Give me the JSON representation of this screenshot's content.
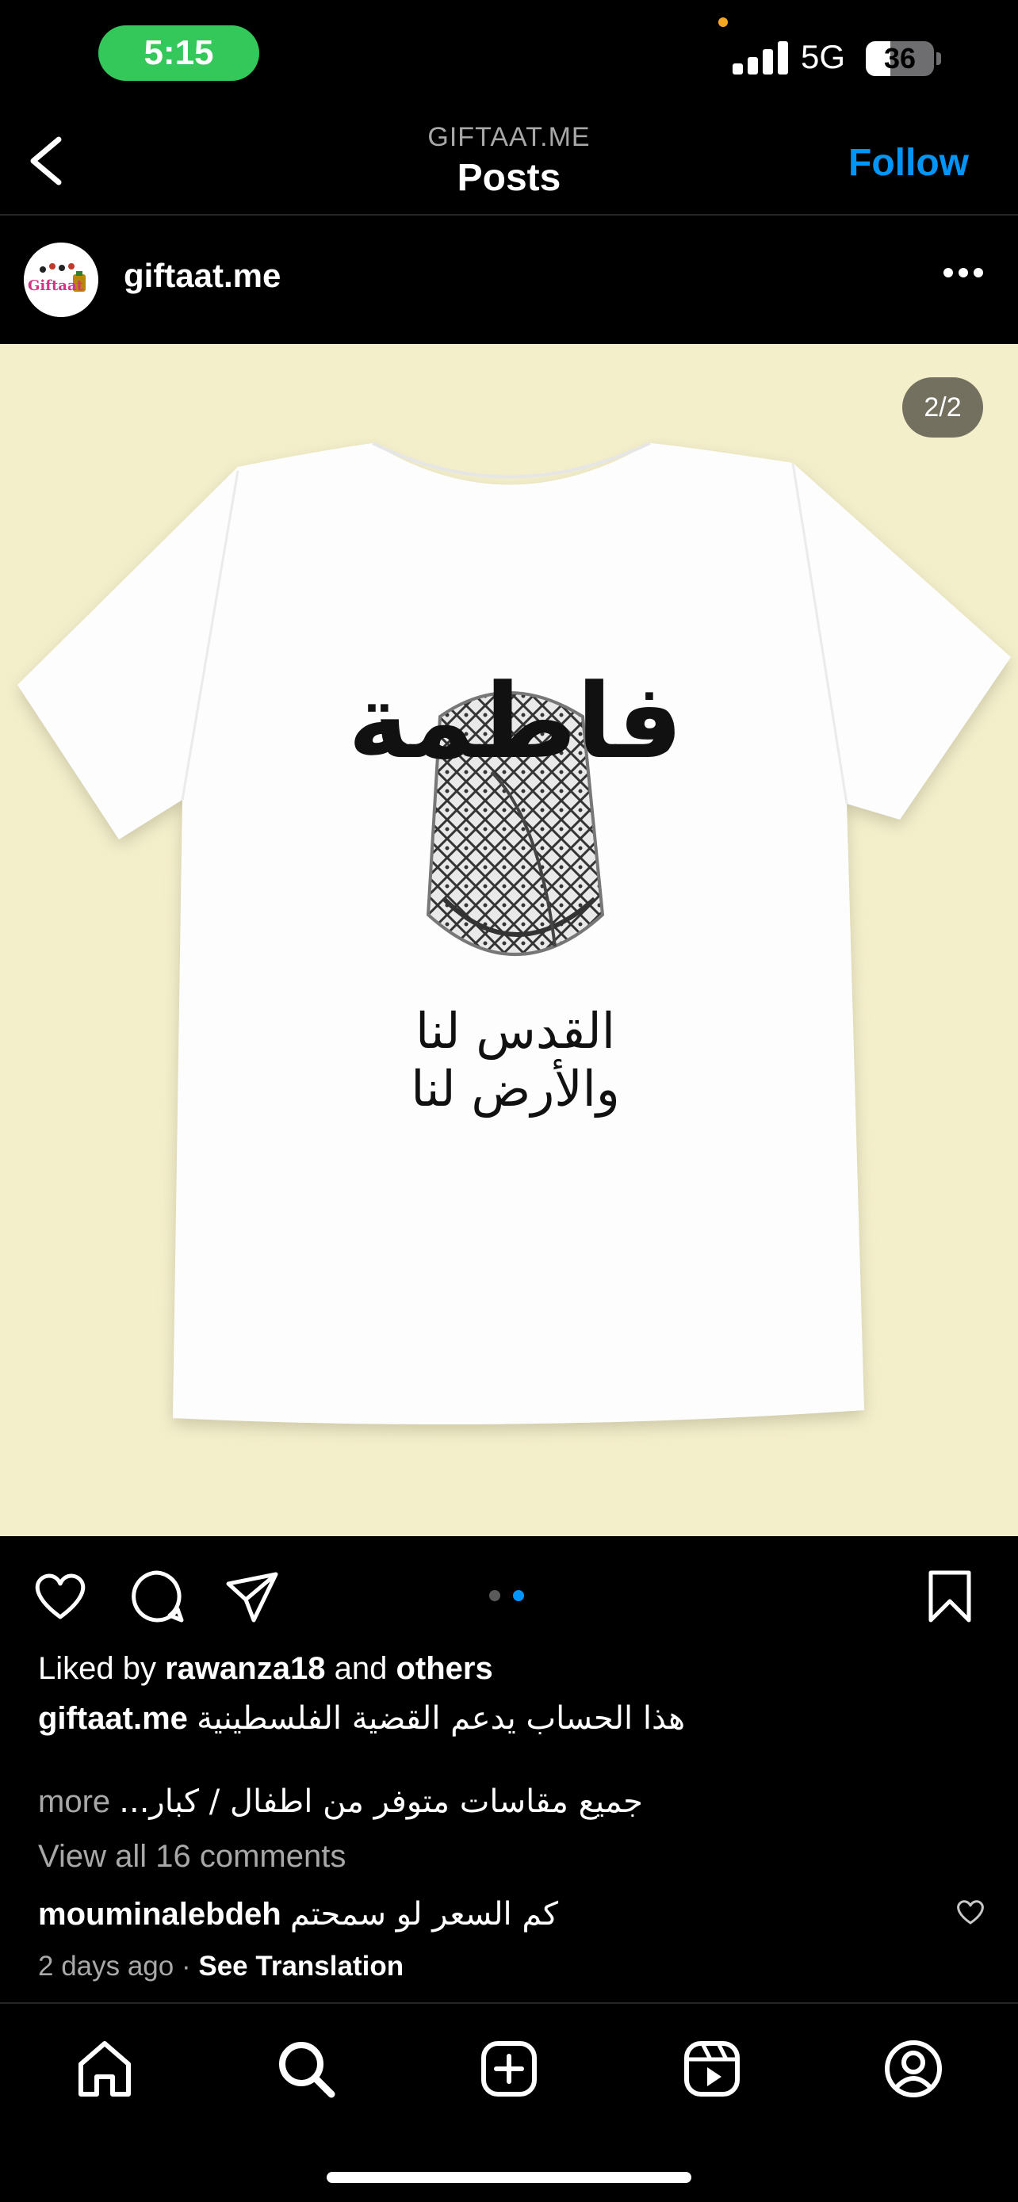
{
  "status_bar": {
    "time": "5:15",
    "network": "5G",
    "battery": "36",
    "battery_level": 0.36
  },
  "nav": {
    "subtitle": "GIFTAAT.ME",
    "title": "Posts",
    "follow_label": "Follow"
  },
  "post": {
    "username": "giftaat.me",
    "avatar_text": "Giftaat",
    "image_counter": "2/2",
    "shirt_name_text": "فاطمة",
    "shirt_tagline_text": "القدس لنا والأرض لنا",
    "carousel": {
      "count": 2,
      "active_index": 1
    },
    "likes": {
      "prefix": "Liked by",
      "user": "rawanza18",
      "middle": "and",
      "suffix": "others"
    },
    "caption_user": "giftaat.me",
    "caption_line1": "هذا الحساب يدعم القضية الفلسطينية",
    "caption_line2": "جميع مقاسات متوفر من اطفال / كبار...",
    "caption_more": "more",
    "view_comments": "View all 16 comments",
    "comment": {
      "user": "mouminalebdeh",
      "text": "كم السعر لو سمحتم"
    },
    "time_ago": "2 days ago",
    "separator": "·",
    "see_translation": "See Translation"
  },
  "colors": {
    "accent": "#0095f6",
    "time_pill": "#34c759",
    "image_bg": "#f4efcb",
    "dot_active": "#0095f6",
    "dot_inactive": "#5a5a5a"
  },
  "icons": {
    "back": "chevron-left-icon",
    "more": "ellipsis-icon",
    "like": "heart-icon",
    "comment": "comment-bubble-icon",
    "share": "paper-plane-icon",
    "save": "bookmark-icon",
    "tabs": [
      "home-icon",
      "search-icon",
      "create-plus-icon",
      "reels-icon",
      "profile-icon"
    ]
  }
}
